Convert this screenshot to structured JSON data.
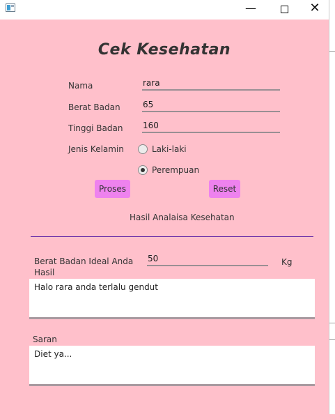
{
  "form": {
    "title": "Cek Kesehatan",
    "nama_label": "Nama",
    "nama_value": "rara",
    "berat_label": "Berat Badan",
    "berat_value": "65",
    "tinggi_label": "Tinggi Badan",
    "tinggi_value": "160",
    "jk_label": "Jenis Kelamin",
    "options": [
      {
        "label": "Laki-laki",
        "checked": false
      },
      {
        "label": "Perempuan",
        "checked": true
      }
    ],
    "proses_label": "Proses",
    "reset_label": "Reset"
  },
  "result": {
    "heading": "Hasil Analaisa Kesehatan",
    "ideal_label": "Berat Badan Ideal Anda",
    "ideal_value": "50",
    "ideal_unit": "Kg",
    "hasil_label": "Hasil",
    "hasil_text": "Halo rara anda terlalu gendut",
    "saran_label": "Saran",
    "saran_text": "Diet ya..."
  }
}
